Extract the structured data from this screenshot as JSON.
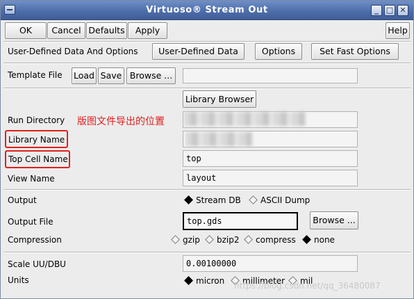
{
  "window": {
    "title": "Virtuoso® Stream Out"
  },
  "icons": {
    "minimize": "_",
    "maximize": "□",
    "close": "✕"
  },
  "toolbar": {
    "ok": "OK",
    "cancel": "Cancel",
    "defaults": "Defaults",
    "apply": "Apply",
    "help": "Help"
  },
  "user_data": {
    "label": "User-Defined Data And Options",
    "user_defined_button": "User-Defined Data",
    "options_button": "Options",
    "fast_options_button": "Set Fast Options"
  },
  "template": {
    "label": "Template File",
    "load": "Load",
    "save": "Save",
    "browse": "Browse ...",
    "value": ""
  },
  "library_browser": "Library Browser",
  "run_directory": {
    "label": "Run Directory"
  },
  "library_name": {
    "label": "Library Name"
  },
  "top_cell": {
    "label": "Top Cell Name",
    "value": "top"
  },
  "view_name": {
    "label": "View Name",
    "value": "layout"
  },
  "annotation": "版图文件导出的位置",
  "output": {
    "label": "Output",
    "options": [
      "Stream DB",
      "ASCII Dump"
    ],
    "selected": "Stream DB"
  },
  "output_file": {
    "label": "Output File",
    "value": "top.gds",
    "browse": "Browse ..."
  },
  "compression": {
    "label": "Compression",
    "options": [
      "gzip",
      "bzip2",
      "compress",
      "none"
    ],
    "selected": "none"
  },
  "scale": {
    "label": "Scale UU/DBU",
    "value": "0.00100000"
  },
  "units": {
    "label": "Units",
    "options": [
      "micron",
      "millimeter",
      "mil"
    ],
    "selected": "micron"
  },
  "watermark": "https://blog.csdn.net/qq_36480087"
}
